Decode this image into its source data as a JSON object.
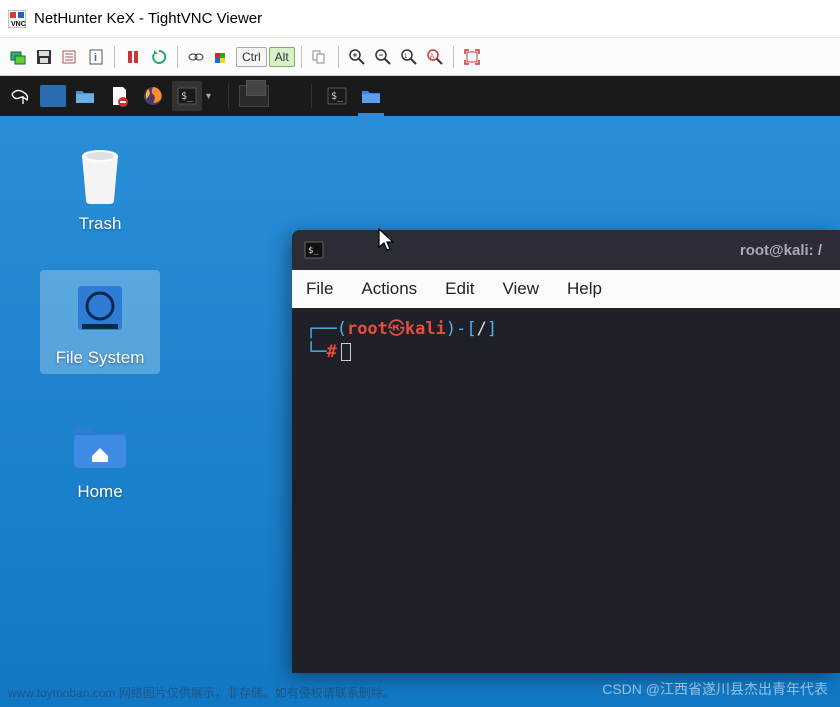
{
  "window": {
    "title": "NetHunter KeX - TightVNC Viewer"
  },
  "vnc_toolbar": {
    "ctrl_label": "Ctrl",
    "alt_label": "Alt"
  },
  "desktop": {
    "icons": {
      "trash": "Trash",
      "filesystem": "File System",
      "home": "Home"
    }
  },
  "terminal": {
    "title": "root@kali: /",
    "menu": {
      "file": "File",
      "actions": "Actions",
      "edit": "Edit",
      "view": "View",
      "help": "Help"
    },
    "prompt": {
      "user": "root",
      "skull": "㉿",
      "host": "kali",
      "path": "/",
      "hash": "#"
    }
  },
  "watermark": {
    "left": "www.toymoban.com 网络图片仅供展示，非存储。如有侵权请联系删除。",
    "right": "CSDN @江西省遂川县杰出青年代表"
  }
}
